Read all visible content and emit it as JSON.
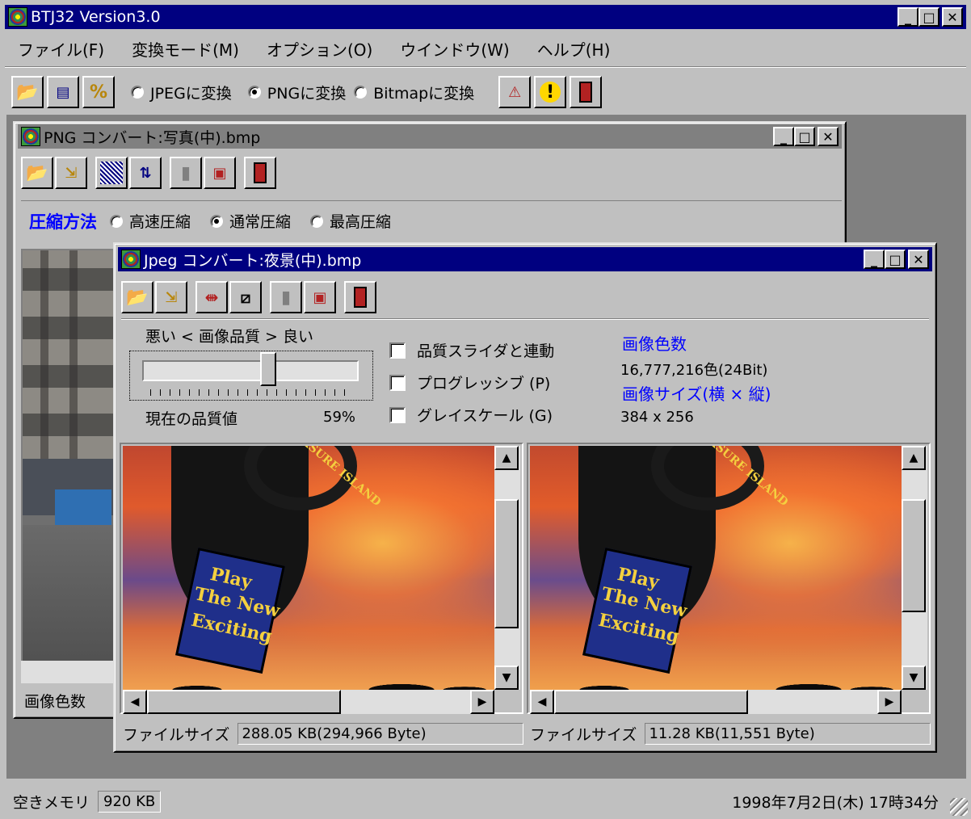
{
  "app": {
    "title": "BTJ32 Version3.0",
    "menu": [
      "ファイル(F)",
      "変換モード(M)",
      "オプション(O)",
      "ウインドウ(W)",
      "ヘルプ(H)"
    ],
    "convert_modes": [
      {
        "label": "JPEGに変換",
        "selected": false
      },
      {
        "label": "PNGに変換",
        "selected": true
      },
      {
        "label": "Bitmapに変換",
        "selected": false
      }
    ]
  },
  "png_window": {
    "title": "PNG コンバート:写真(中).bmp",
    "compression_label": "圧縮方法",
    "compression_options": [
      {
        "label": "高速圧縮",
        "selected": false
      },
      {
        "label": "通常圧縮",
        "selected": true
      },
      {
        "label": "最高圧縮",
        "selected": false
      }
    ],
    "footer_label": "画像色数"
  },
  "jpeg_window": {
    "title": "Jpeg コンバート:夜景(中).bmp",
    "quality_header": "悪い < 画像品質 > 良い",
    "quality_value_label": "現在の品質値",
    "quality_value": "59%",
    "quality_fraction": 0.59,
    "options": [
      {
        "label": "品質スライダと連動",
        "checked": false
      },
      {
        "label": "プログレッシブ (P)",
        "checked": false
      },
      {
        "label": "グレイスケール (G)",
        "checked": false
      }
    ],
    "color_count_label": "画像色数",
    "color_count_value": "16,777,216色(24Bit)",
    "image_size_label": "画像サイズ(横 × 縦)",
    "image_size_value": "384 x 256",
    "sign_text": [
      "Play",
      "The New",
      "Exciting"
    ],
    "sign_top": "TREASURE ISLAND",
    "left_pane": {
      "file_size_label": "ファイルサイズ",
      "file_size_value": "288.05 KB(294,966 Byte)"
    },
    "right_pane": {
      "file_size_label": "ファイルサイズ",
      "file_size_value": "11.28 KB(11,551 Byte)"
    }
  },
  "statusbar": {
    "free_memory_label": "空きメモリ",
    "free_memory_value": "920 KB",
    "datetime": "1998年7月2日(木) 17時34分"
  },
  "colors": {
    "title_active": "#000080",
    "face": "#c0c0c0",
    "workspace": "#808080",
    "blue_text": "#0000ff"
  }
}
